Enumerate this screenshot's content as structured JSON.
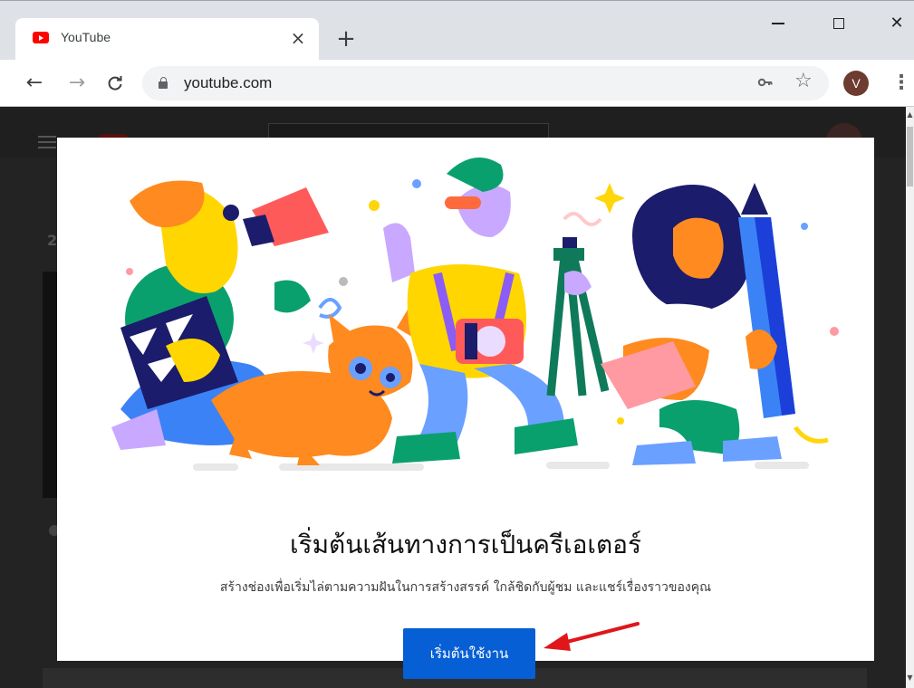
{
  "browser": {
    "tab": {
      "title": "YouTube",
      "close_glyph": "×"
    },
    "new_tab_glyph": "+",
    "window_controls": {
      "close_glyph": "✕"
    },
    "nav": {
      "back_glyph": "←",
      "forward_glyph": "→",
      "reload_glyph": "C"
    },
    "address_bar": {
      "url": "youtube.com"
    },
    "toolbar_icons": {
      "key": "key-icon",
      "star_glyph": "☆"
    },
    "profile": {
      "initial": "V"
    },
    "menu_glyph": "⋮"
  },
  "background_page": {
    "logo_text": "YouTube",
    "row_number": "2"
  },
  "modal": {
    "title": "เริ่มต้นเส้นทางการเป็นครีเอเตอร์",
    "description": "สร้างช่องเพื่อเริ่มไล่ตามความฝันในการสร้างสรรค์ ใกล้ชิดกับผู้ชม และแชร์เรื่องราวของคุณ",
    "button_label": "เริ่มต้นใช้งาน"
  },
  "colors": {
    "accent": "#065fd4",
    "youtube_red": "#ff0000",
    "arrow": "#e0161b"
  }
}
